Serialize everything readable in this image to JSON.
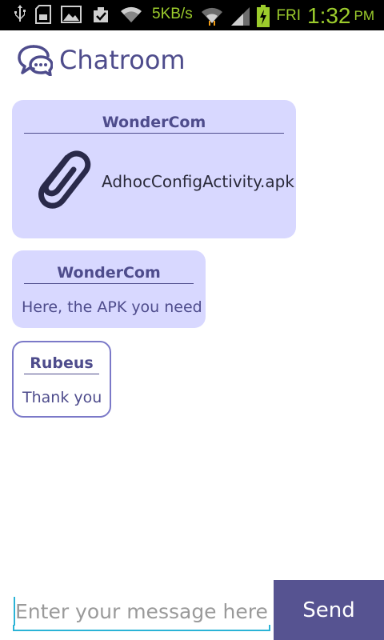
{
  "status_bar": {
    "icons_left": [
      "usb-icon",
      "sd-card-icon",
      "image-icon",
      "download-done-icon",
      "wifi-icon"
    ],
    "speed": "5KB/s",
    "icons_right": [
      "wifi-icon",
      "signal-icon",
      "battery-charging-icon"
    ],
    "day": "FRI",
    "time": "1:32",
    "ampm": "PM",
    "colors": {
      "bg": "#000000",
      "accent": "#9ccc2c"
    }
  },
  "header": {
    "icon": "chat-bubbles-icon",
    "title": "Chatroom"
  },
  "messages": [
    {
      "sender": "WonderCom",
      "type": "file",
      "icon": "paperclip-icon",
      "filename": "AdhocConfigActivity.apk"
    },
    {
      "sender": "WonderCom",
      "type": "text",
      "text": "Here, the APK you need"
    },
    {
      "sender": "Rubeus",
      "type": "text",
      "text": "Thank you",
      "outgoing": true
    }
  ],
  "composer": {
    "placeholder": "Enter your message here",
    "value": "",
    "send_label": "Send"
  },
  "colors": {
    "primary": "#4e4c8c",
    "bubble_bg": "#d8d8ff",
    "send_bg": "#565391",
    "input_accent": "#2bb3d6"
  }
}
